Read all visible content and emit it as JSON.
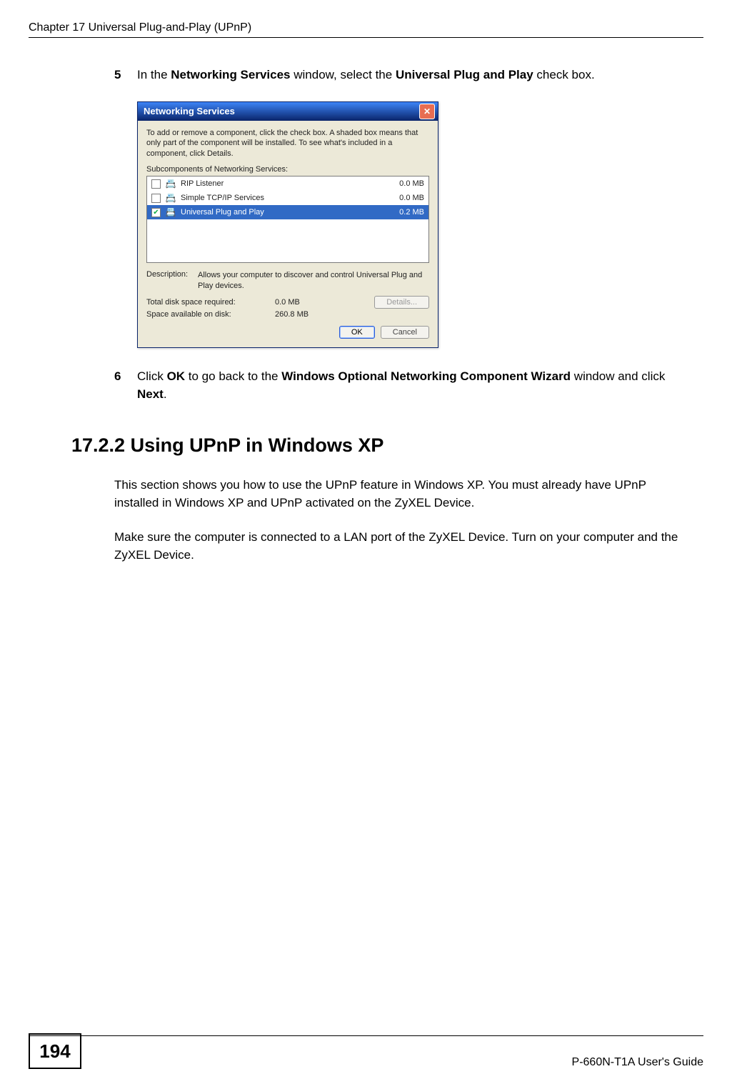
{
  "header": {
    "chapter_line": "Chapter 17 Universal Plug-and-Play (UPnP)"
  },
  "steps": {
    "five": {
      "num": "5",
      "pre": "In the ",
      "b1": "Networking Services",
      "mid": " window, select the ",
      "b2": "Universal Plug and Play",
      "post": " check box."
    },
    "six": {
      "num": "6",
      "pre": "Click ",
      "b1": "OK",
      "mid1": " to go back to the ",
      "b2": "Windows Optional Networking Component Wizard",
      "mid2": " window and click ",
      "b3": "Next",
      "post": "."
    }
  },
  "dialog": {
    "title": "Networking Services",
    "close_glyph": "✕",
    "help_text": "To add or remove a component, click the check box. A shaded box means that only part of the component will be installed. To see what's included in a component, click Details.",
    "sub_label": "Subcomponents of Networking Services:",
    "rows": [
      {
        "checked": false,
        "icon": "📇",
        "name": "RIP Listener",
        "size": "0.0 MB",
        "selected": false
      },
      {
        "checked": false,
        "icon": "📇",
        "name": "Simple TCP/IP Services",
        "size": "0.0 MB",
        "selected": false
      },
      {
        "checked": true,
        "icon": "📇",
        "name": "Universal Plug and Play",
        "size": "0.2 MB",
        "selected": true
      }
    ],
    "description_label": "Description:",
    "description_text": "Allows your computer to discover and control Universal Plug and Play devices.",
    "total_label": "Total disk space required:",
    "total_value": "0.0 MB",
    "avail_label": "Space available on disk:",
    "avail_value": "260.8 MB",
    "details_btn": "Details...",
    "ok_btn": "OK",
    "cancel_btn": "Cancel"
  },
  "section": {
    "number_and_title": "17.2.2  Using UPnP in Windows XP"
  },
  "paragraphs": {
    "p1": "This section shows you how to use the UPnP feature in Windows XP. You must already have UPnP installed in Windows XP and UPnP activated on the ZyXEL Device.",
    "p2": "Make sure the computer is connected to a LAN port of the ZyXEL Device. Turn on your computer and the ZyXEL Device."
  },
  "footer": {
    "page_number": "194",
    "guide": "P-660N-T1A User's Guide"
  }
}
